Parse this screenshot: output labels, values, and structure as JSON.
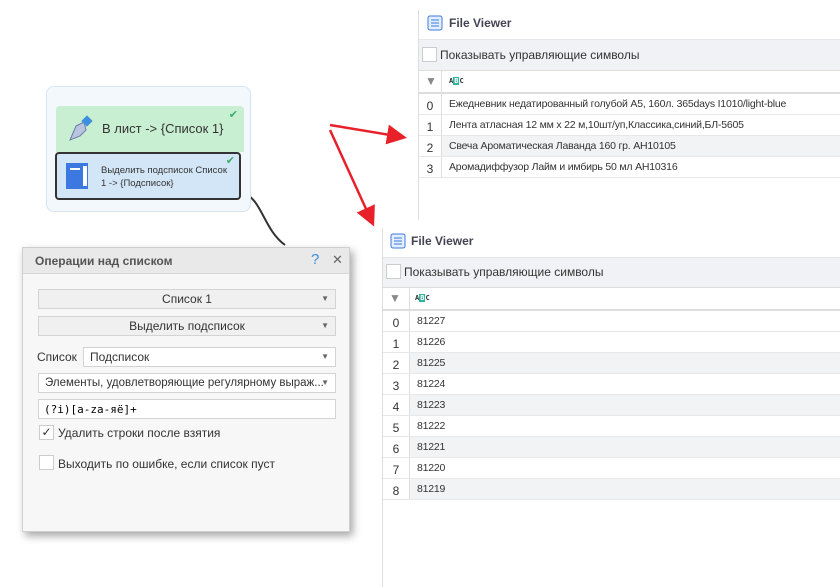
{
  "workflow": {
    "node1": {
      "label": "В лист -> {Список 1}",
      "icon": "pen-icon"
    },
    "node2": {
      "label_line1": "Выделить подсписок Список",
      "label_line2": "1 -> {Подсписок}",
      "icon": "notebook-icon"
    }
  },
  "viewer_top": {
    "title": "File Viewer",
    "show_control_chars": "Показывать управляющие символы",
    "column_icon": "ABC",
    "rows": [
      {
        "index": "0",
        "value": "Ежедневник недатированный голубой А5, 160л. 365days I1010/light-blue"
      },
      {
        "index": "1",
        "value": "Лента атласная 12 мм х 22 м,10шт/уп,Классика,синий,БЛ-5605"
      },
      {
        "index": "2",
        "value": "Свеча Ароматическая Лаванда 160 гр. АН10105"
      },
      {
        "index": "3",
        "value": "Аромадиффузор Лайм и имбирь 50 мл АН10316"
      }
    ]
  },
  "viewer_bottom": {
    "title": "File Viewer",
    "show_control_chars": "Показывать управляющие символы",
    "column_icon": "ABC",
    "rows": [
      {
        "index": "0",
        "value": "81227"
      },
      {
        "index": "1",
        "value": "81226"
      },
      {
        "index": "2",
        "value": "81225"
      },
      {
        "index": "3",
        "value": "81224"
      },
      {
        "index": "4",
        "value": "81223"
      },
      {
        "index": "5",
        "value": "81222"
      },
      {
        "index": "6",
        "value": "81221"
      },
      {
        "index": "7",
        "value": "81220"
      },
      {
        "index": "8",
        "value": "81219"
      }
    ]
  },
  "dialog": {
    "title": "Операции над списком",
    "help": "?",
    "close": "✕",
    "list_select": "Список 1",
    "operation_select": "Выделить подсписок",
    "target_label": "Список",
    "target_select": "Подсписок",
    "mode_select": "Элементы, удовлетворяющие регулярному выраж...",
    "regex": "(?i)[a-zа-яё]+",
    "delete_rows": {
      "label": "Удалить строки после взятия",
      "checked": true
    },
    "exit_on_error": {
      "label": "Выходить по ошибке, если список пуст",
      "checked": false
    }
  },
  "colors": {
    "arrow": "#e8202a",
    "node_green": "#c9efd2",
    "node_blue": "#d3e6f7",
    "badge": "#2bb39b"
  }
}
